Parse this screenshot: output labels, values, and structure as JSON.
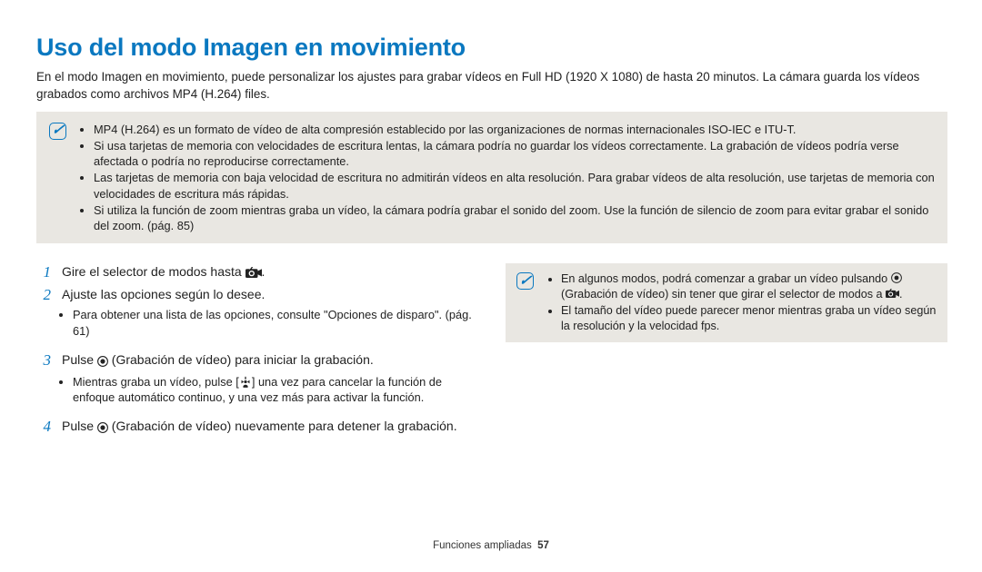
{
  "title": "Uso del modo Imagen en movimiento",
  "intro": "En el modo Imagen en movimiento, puede personalizar los ajustes para grabar vídeos en Full HD (1920 X 1080) de hasta 20 minutos. La cámara guarda los vídeos grabados como archivos MP4 (H.264) files.",
  "mainNote": {
    "items": [
      "MP4 (H.264) es un formato de vídeo de alta compresión establecido por las organizaciones de normas internacionales ISO-IEC e ITU-T.",
      "Si usa tarjetas de memoria con velocidades de escritura lentas, la cámara podría no guardar los vídeos correctamente. La grabación de vídeos podría verse afectada o podría no reproducirse correctamente.",
      "Las tarjetas de memoria con baja velocidad de escritura no admitirán vídeos en alta resolución. Para grabar vídeos de alta resolución, use tarjetas de memoria con velocidades de escritura más rápidas.",
      "Si utiliza la función de zoom mientras graba un vídeo, la cámara podría grabar el sonido del zoom. Use la función de silencio de zoom para evitar grabar el sonido del zoom. (pág. 85)"
    ]
  },
  "steps": {
    "s1": {
      "num": "1",
      "pre": "Gire el selector de modos hasta ",
      "post": "."
    },
    "s2": {
      "num": "2",
      "text": "Ajuste las opciones según lo desee.",
      "bullet": "Para obtener una lista de las opciones, consulte \"Opciones de disparo\". (pág. 61)"
    },
    "s3": {
      "num": "3",
      "pre": "Pulse ",
      "mid": " (Grabación de vídeo) para iniciar la grabación.",
      "bulletPre": "Mientras graba un vídeo, pulse [",
      "bulletPost": "] una vez para cancelar la función de enfoque automático continuo, y una vez más para activar la función."
    },
    "s4": {
      "num": "4",
      "pre": "Pulse ",
      "mid": " (Grabación de vídeo) nuevamente para detener la grabación."
    }
  },
  "sideNote": {
    "items": {
      "a_pre": "En algunos modos, podrá comenzar a grabar un vídeo pulsando ",
      "a_mid": " (Grabación de vídeo) sin tener que girar el selector de modos a ",
      "a_post": ".",
      "b": "El tamaño del vídeo puede parecer menor mientras graba un vídeo según la resolución y la velocidad fps."
    }
  },
  "footer": {
    "section": "Funciones ampliadas",
    "page": "57"
  }
}
